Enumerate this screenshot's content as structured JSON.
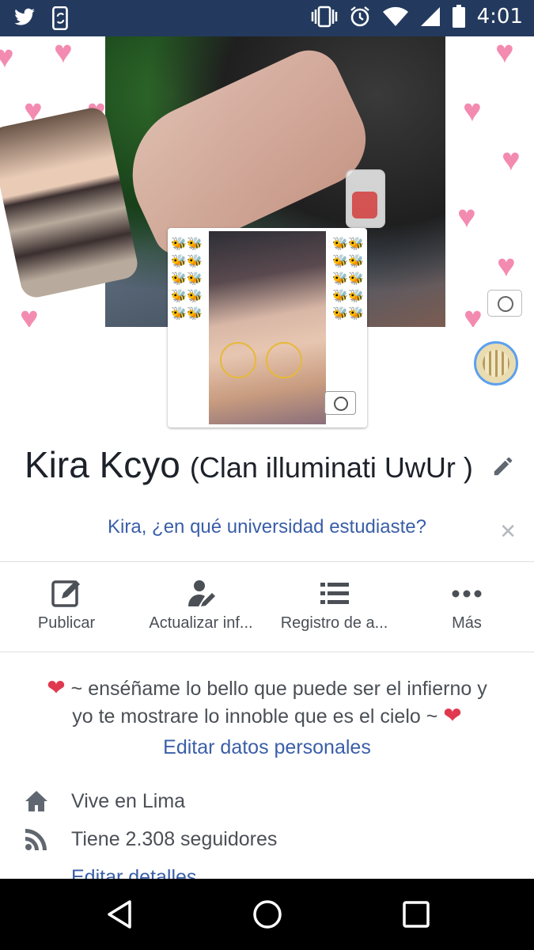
{
  "status_bar": {
    "time": "4:01",
    "left_icons": [
      "twitter-icon",
      "phone-sync-icon"
    ],
    "right_icons": [
      "vibrate-icon",
      "alarm-icon",
      "wifi-icon",
      "signal-icon",
      "battery-icon"
    ]
  },
  "profile": {
    "name": "Kira Kcyo",
    "alternate_name": "(Clan illuminati UwUr )"
  },
  "prompt": {
    "question": "Kira, ¿en qué universidad estudiaste?"
  },
  "actions": [
    {
      "label": "Publicar",
      "icon": "compose-icon"
    },
    {
      "label": "Actualizar inf...",
      "icon": "edit-person-icon"
    },
    {
      "label": "Registro de a...",
      "icon": "list-icon"
    },
    {
      "label": "Más",
      "icon": "more-icon"
    }
  ],
  "bio": {
    "line1": "~ enséñame lo bello que puede ser el infierno y",
    "line2": "yo te mostrare lo innoble que es el cielo ~",
    "edit_link": "Editar datos personales"
  },
  "details": [
    {
      "icon": "home-icon",
      "text": "Vive en Lima"
    },
    {
      "icon": "rss-icon",
      "text": "Tiene 2.308 seguidores"
    }
  ],
  "edit_details_link": "Editar detalles",
  "colors": {
    "status_bar": "#233a5e",
    "link": "#3a5ea8",
    "text": "#4b4f56",
    "heart": "#e0394f"
  }
}
